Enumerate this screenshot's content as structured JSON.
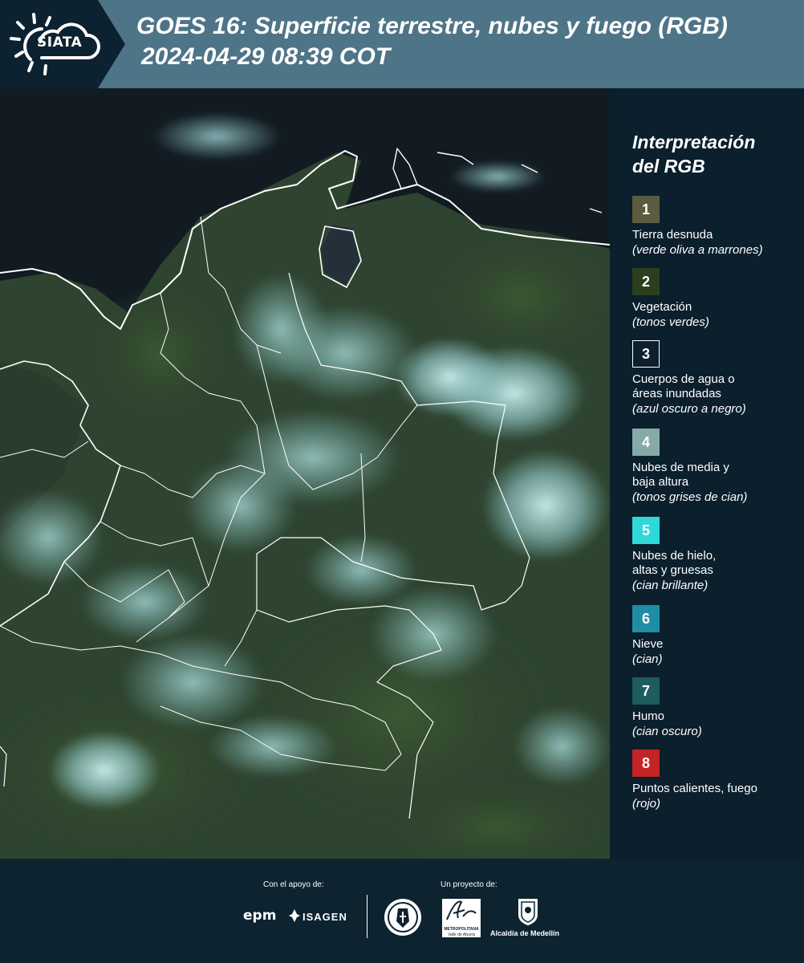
{
  "header": {
    "logo_text": "SIATA",
    "title_line1": "GOES 16: Superficie terrestre, nubes y fuego (RGB)",
    "title_line2": "2024-04-29 08:39 COT"
  },
  "legend": {
    "title_line1": "Interpretación",
    "title_line2": "del RGB",
    "items": [
      {
        "num": "1",
        "color": "#5b5b40",
        "label": "Tierra desnuda",
        "sub": "(verde oliva a marrones)"
      },
      {
        "num": "2",
        "color": "#2b3f1f",
        "label": "Vegetación",
        "sub": "(tonos verdes)"
      },
      {
        "num": "3",
        "color": "#0b1f2c",
        "label": "Cuerpos de agua o\náreas inundadas",
        "sub": "(azul oscuro a negro)"
      },
      {
        "num": "4",
        "color": "#86aaa7",
        "label": "Nubes de media y\nbaja altura",
        "sub": "(tonos grises de cian)"
      },
      {
        "num": "5",
        "color": "#2fd8d8",
        "label": "Nubes de hielo,\naltas y gruesas",
        "sub": "(cian brillante)"
      },
      {
        "num": "6",
        "color": "#1f8ea5",
        "label": "Nieve",
        "sub": "(cian)"
      },
      {
        "num": "7",
        "color": "#1e5c5e",
        "label": "Humo",
        "sub": "(cian oscuro)"
      },
      {
        "num": "8",
        "color": "#c42424",
        "label": "Puntos calientes, fuego",
        "sub": "(rojo)"
      }
    ]
  },
  "footer": {
    "support_label": "Con el apoyo de:",
    "project_label": "Un proyecto de:",
    "brand_epm": "epm",
    "brand_isagen": "ISAGEN",
    "brand_area_line1": "METROPOLITANA",
    "brand_area_line2": "Valle de Aburrá",
    "brand_alcaldia": "Alcaldía de Medellín"
  }
}
